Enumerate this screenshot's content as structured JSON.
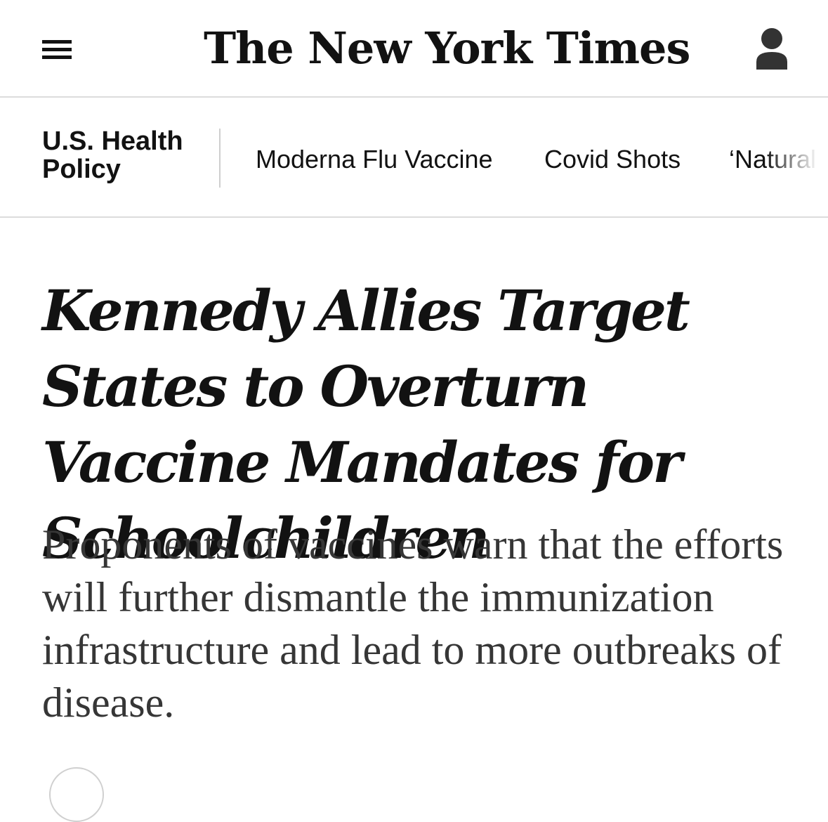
{
  "header": {
    "logo_text": "The New York Times"
  },
  "section_nav": {
    "section_label": "U.S. Health Policy",
    "links": [
      "Moderna Flu Vaccine",
      "Covid Shots",
      "‘Natural"
    ]
  },
  "article": {
    "headline": "Kennedy Allies Target States to Overturn Vaccine Mandates for Schoolchildren",
    "summary": "Proponents of vaccines warn that the efforts will further dismantle the immunization infrastructure and lead to more outbreaks of disease."
  },
  "icons": {
    "menu": "hamburger-menu-icon",
    "account": "user-account-icon"
  }
}
